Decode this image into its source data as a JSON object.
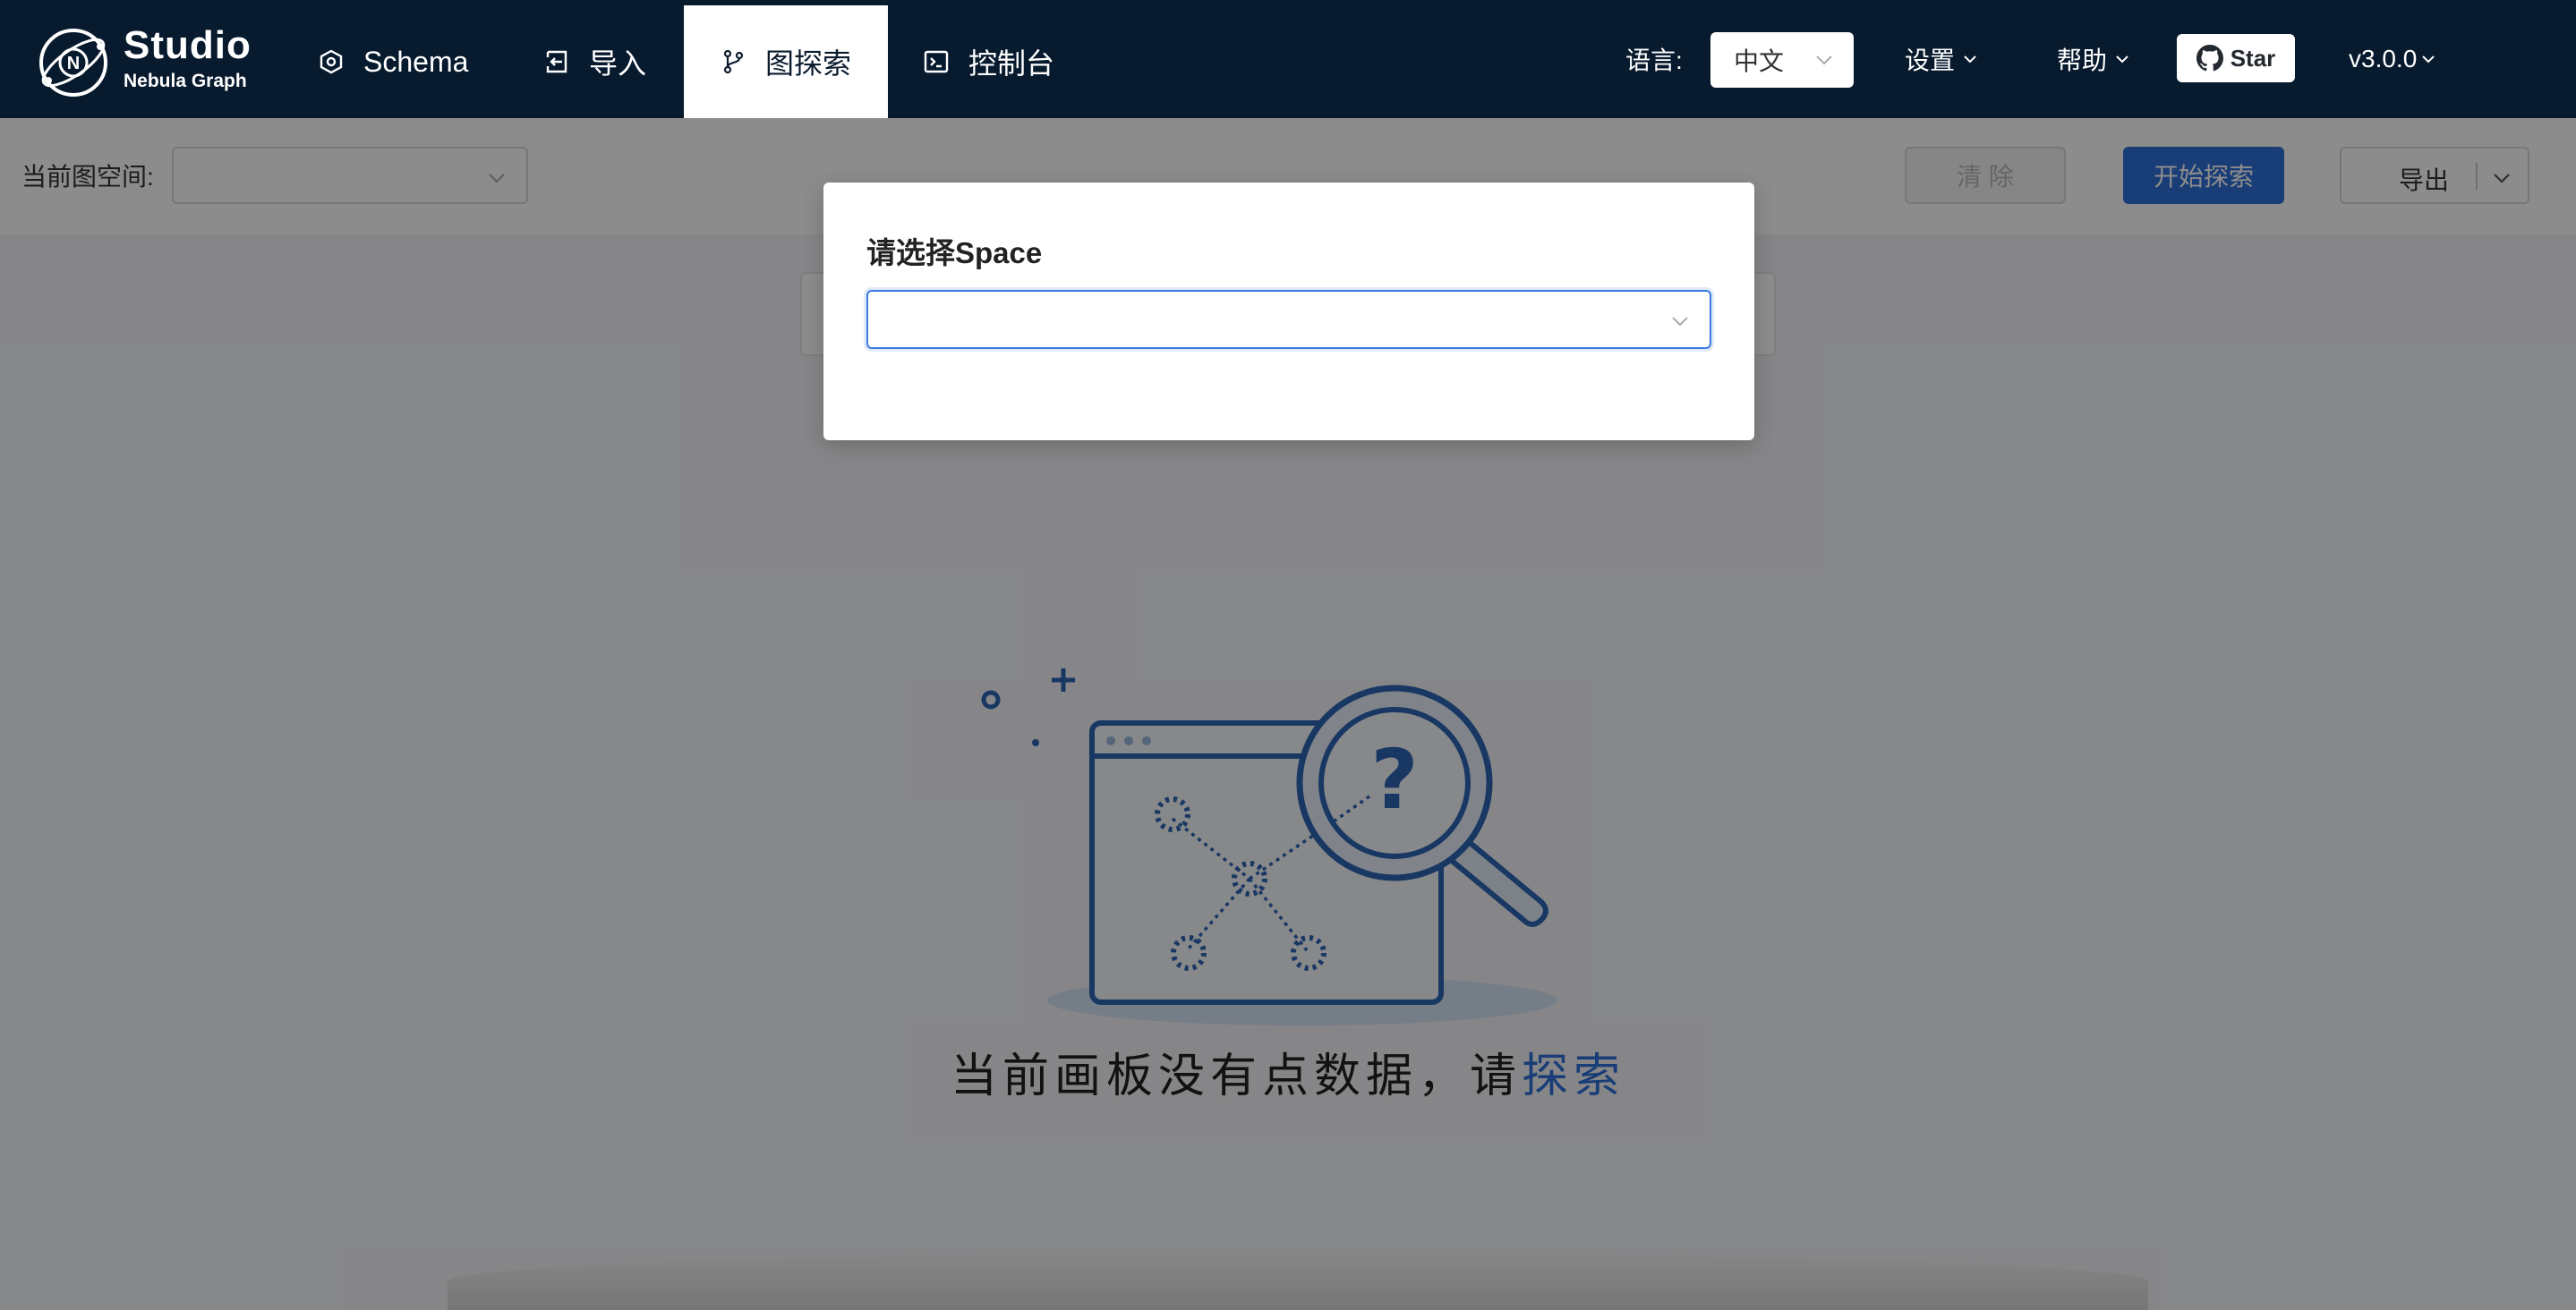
{
  "header": {
    "logo": {
      "title": "Studio",
      "subtitle": "Nebula Graph",
      "icon": "nebula-logo-icon"
    },
    "nav": [
      {
        "label": "Schema",
        "icon": "schema-icon",
        "active": false
      },
      {
        "label": "导入",
        "icon": "import-icon",
        "active": false
      },
      {
        "label": "图探索",
        "icon": "explore-branch-icon",
        "active": true
      },
      {
        "label": "控制台",
        "icon": "console-icon",
        "active": false
      }
    ],
    "language_label": "语言:",
    "language_value": "中文",
    "settings_label": "设置",
    "help_label": "帮助",
    "star_label": "Star",
    "version": "v3.0.0"
  },
  "toolbar": {
    "space_label": "当前图空间:",
    "space_value": "",
    "clear_label": "清 除",
    "start_label": "开始探索",
    "export_label": "导出"
  },
  "canvas": {
    "empty_text": "当前画板没有点数据，请",
    "empty_link": "探索"
  },
  "modal": {
    "title": "请选择Space",
    "select_value": ""
  },
  "colors": {
    "header_bg": "#071a2e",
    "primary": "#2f6fd8",
    "mask": "rgba(0,0,0,0.45)"
  }
}
